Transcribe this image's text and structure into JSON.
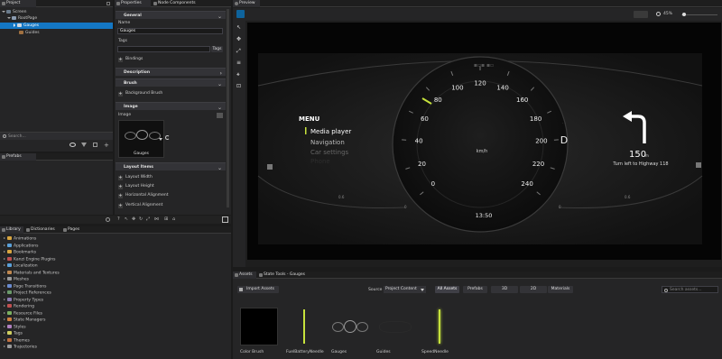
{
  "project": {
    "tab": "Project",
    "tree": [
      {
        "label": "Screen",
        "level": 0
      },
      {
        "label": "RootPage",
        "level": 1
      },
      {
        "label": "Gauges",
        "level": 2
      },
      {
        "label": "Guides",
        "level": 2
      }
    ],
    "search_placeholder": "Search..."
  },
  "prefabs": {
    "tab": "Prefabs"
  },
  "properties": {
    "tabs": [
      "Properties",
      "Node Components"
    ],
    "general": "General",
    "name_label": "Name",
    "name_value": "Gauges",
    "tags_label": "Tags",
    "tags_button": "Tags",
    "bindings": "Bindings",
    "description": "Description",
    "brush": "Brush",
    "background_brush": "Background Brush",
    "image_section": "Image",
    "image_label": "Image",
    "image_name": "Gauges",
    "layout_items": "Layout Items",
    "layout_rows": [
      "Layout Width",
      "Layout Height",
      "Horizontal Alignment",
      "Vertical Alignment"
    ]
  },
  "library": {
    "tabs": [
      "Library",
      "Dictionaries",
      "Pages"
    ],
    "items": [
      "Animations",
      "Applications",
      "Bookmarks",
      "Kanzi Engine Plugins",
      "Localization",
      "Materials and Textures",
      "Meshes",
      "Page Transitions",
      "Project References",
      "Property Types",
      "Rendering",
      "Resource Files",
      "State Managers",
      "Styles",
      "Tags",
      "Themes",
      "Trajectories"
    ],
    "colors": [
      "#d9a640",
      "#5aa0d8",
      "#d9a640",
      "#c05050",
      "#5aa0d8",
      "#c08850",
      "#9a9a9a",
      "#6a8bd0",
      "#6a9a6a",
      "#8a7ab0",
      "#c05050",
      "#7ab060",
      "#d08040",
      "#b080c0",
      "#d0d060",
      "#c07040",
      "#9a9a9a"
    ]
  },
  "preview": {
    "tab": "Preview",
    "zoom": "45%",
    "dashboard": {
      "menu_title": "MENU",
      "menu_items": [
        "Media player",
        "Navigation",
        "Car settings",
        "Phone"
      ],
      "speed_ticks": [
        "0",
        "20",
        "40",
        "60",
        "80",
        "100",
        "120",
        "140",
        "160",
        "180",
        "200",
        "220",
        "240"
      ],
      "unit": "km/h",
      "gear": "D",
      "distance": "150",
      "distance_unit": "m",
      "nav_text": "Turn left to Highway 118",
      "time": "13:50",
      "left_gauge": [
        "0.6",
        "0"
      ],
      "right_gauge": [
        "0.6",
        "0"
      ]
    }
  },
  "assets": {
    "tabs": [
      "Assets",
      "State Tools - Gauges"
    ],
    "import_button": "Import Assets",
    "source_label": "Source",
    "source_value": "Project Content",
    "filters": [
      "All Assets",
      "Prefabs",
      "3D",
      "2D",
      "Materials"
    ],
    "search_placeholder": "Search assets...",
    "items": [
      "Color Brush",
      "FuelBatteryNeedle",
      "Gauges",
      "Guides",
      "SpeedNeedle"
    ]
  },
  "colors": {
    "accent": "#0e639c",
    "selection": "#1477c4",
    "needle": "#c6e23c",
    "panel": "#252526",
    "background": "#1b1b1b"
  }
}
